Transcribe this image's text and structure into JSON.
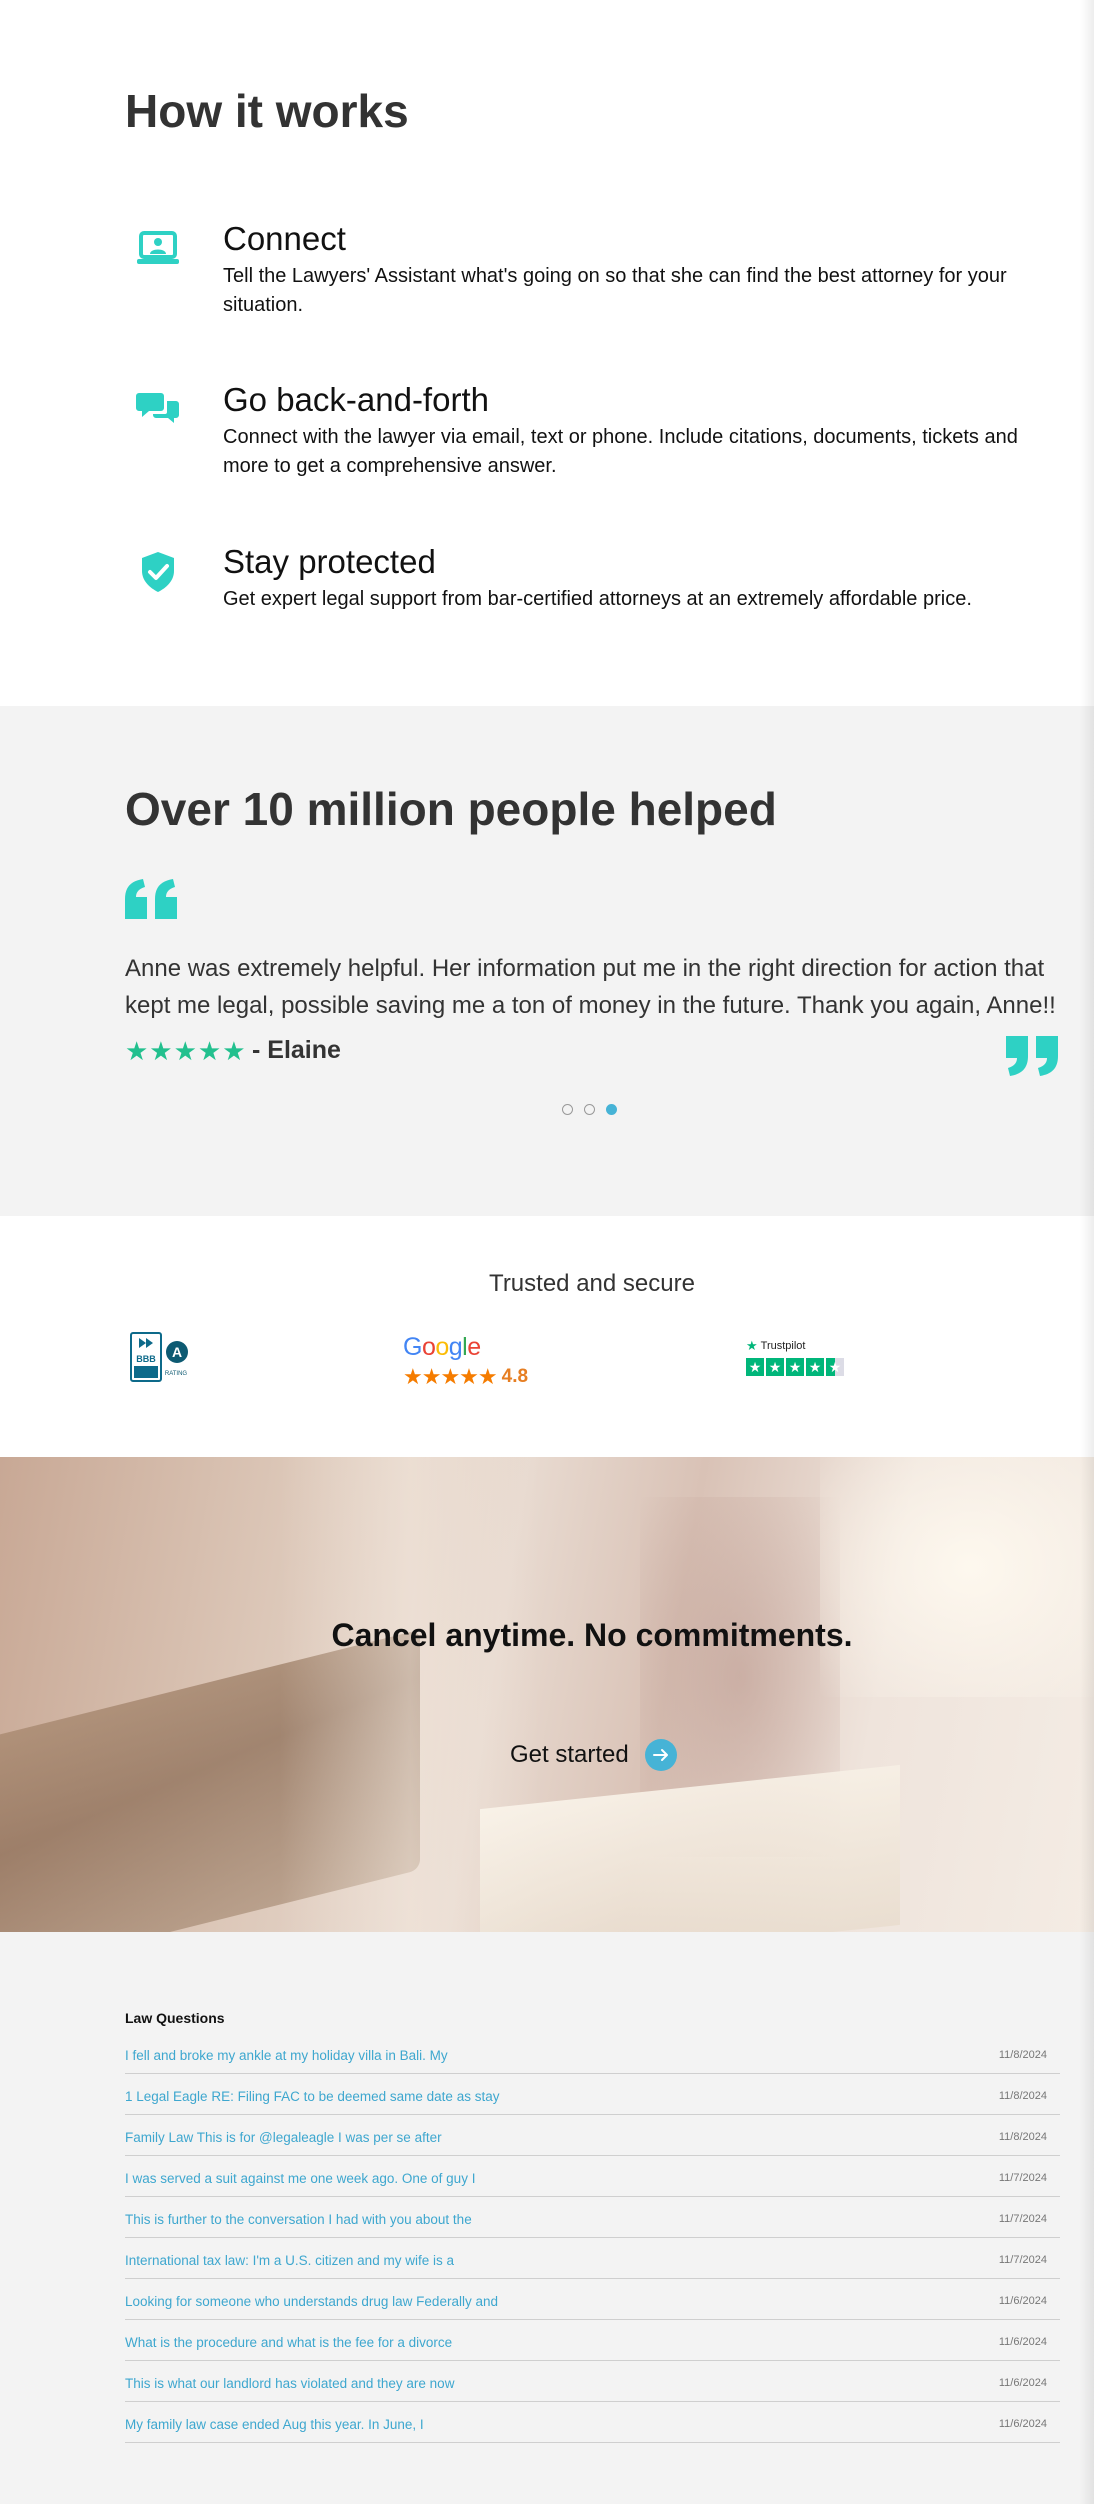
{
  "how_it_works": {
    "heading": "How it works",
    "steps": [
      {
        "icon": "laptop-user-icon",
        "title": "Connect",
        "desc": "Tell the Lawyers' Assistant what's going on so that she can find the best attorney for your situation."
      },
      {
        "icon": "chat-bubbles-icon",
        "title": "Go back-and-forth",
        "desc": "Connect with the lawyer via email, text or phone. Include citations, documents, tickets and more to get a comprehensive answer."
      },
      {
        "icon": "shield-check-icon",
        "title": "Stay protected",
        "desc": "Get expert legal support from bar-certified attorneys at an extremely affordable price."
      }
    ]
  },
  "testimonials": {
    "heading": "Over 10 million people helped",
    "quote": "Anne was extremely helpful. Her information put me in the right direction for action that kept me legal, possible saving me a ton of money in the future. Thank you again, Anne!!",
    "stars": "★★★★★",
    "author": "- Elaine",
    "rating_stars": 5,
    "slides": 3,
    "active_slide": 3
  },
  "trusted": {
    "heading": "Trusted and secure",
    "bbb": {
      "grade": "A",
      "label": "RATING",
      "seal": "BBB"
    },
    "google": {
      "word": "Google",
      "stars": "★★★★★",
      "score": "4.8"
    },
    "trustpilot": {
      "label": "Trustpilot",
      "stars": 4.5
    }
  },
  "cta": {
    "headline": "Cancel anytime. No commitments.",
    "button": "Get started"
  },
  "law_questions": {
    "heading": "Law Questions",
    "items": [
      {
        "q": "I fell and broke my ankle at my holiday villa in Bali. My",
        "date": "11/8/2024"
      },
      {
        "q": "1 Legal Eagle RE: Filing FAC to be deemed same date as stay",
        "date": "11/8/2024"
      },
      {
        "q": "Family Law This is for @legaleagle I was per se after",
        "date": "11/8/2024"
      },
      {
        "q": "I was served a suit against me one week ago. One of guy I",
        "date": "11/7/2024"
      },
      {
        "q": "This is further to the conversation I had with you about the",
        "date": "11/7/2024"
      },
      {
        "q": "International tax law: I'm a U.S. citizen and my wife is a",
        "date": "11/7/2024"
      },
      {
        "q": "Looking for someone who understands drug law Federally and",
        "date": "11/6/2024"
      },
      {
        "q": "What is the procedure and what is the fee for a divorce",
        "date": "11/6/2024"
      },
      {
        "q": "This is what our landlord has violated and they are now",
        "date": "11/6/2024"
      },
      {
        "q": "My family law case ended Aug this year. In June, I",
        "date": "11/6/2024"
      }
    ]
  },
  "colors": {
    "accent": "#2ed1c4",
    "link": "#3ea7cf",
    "star_green": "#22c08e",
    "google_orange": "#f57c00",
    "trustpilot": "#00b67a"
  }
}
